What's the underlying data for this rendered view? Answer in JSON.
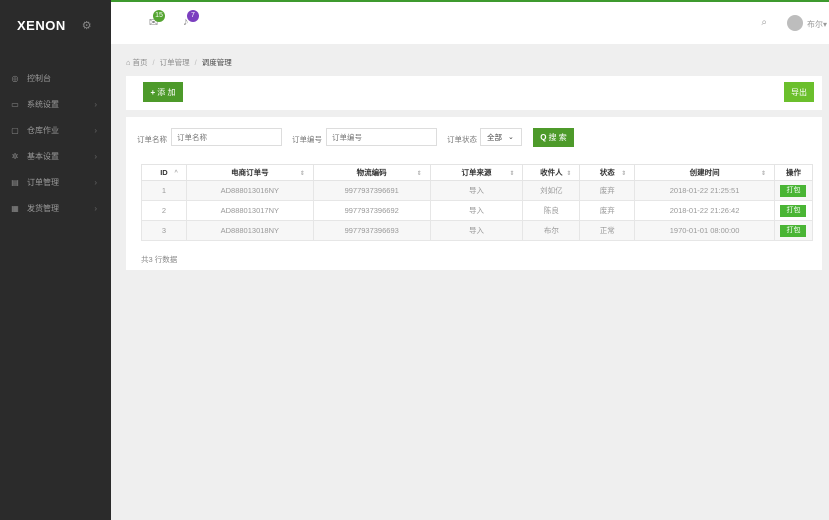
{
  "sidebar": {
    "brand": "XENON",
    "brand_icon": "gear-icon",
    "items": [
      {
        "icon": "dashboard-icon",
        "glyph": "◎",
        "label": "控制台",
        "has_children": false
      },
      {
        "icon": "monitor-icon",
        "glyph": "▭",
        "label": "系统设置",
        "has_children": true
      },
      {
        "icon": "warehouse-icon",
        "glyph": "▢",
        "label": "仓库作业",
        "has_children": true
      },
      {
        "icon": "settings-icon",
        "glyph": "✲",
        "label": "基本设置",
        "has_children": true
      },
      {
        "icon": "orders-icon",
        "glyph": "▤",
        "label": "订单管理",
        "has_children": true
      },
      {
        "icon": "shipping-icon",
        "glyph": "▦",
        "label": "发货管理",
        "has_children": true
      }
    ],
    "chevron": "›"
  },
  "header": {
    "messages_badge": "15",
    "notifications_badge": "7",
    "username": "布尔",
    "user_caret": "▾"
  },
  "breadcrumb": {
    "home": "首页",
    "parent": "订单管理",
    "current": "调度管理",
    "separator": "/"
  },
  "toolbar": {
    "add_label": "添 加",
    "add_glyph": "+",
    "export_label": "导出"
  },
  "filters": {
    "order_name_label": "订单名称",
    "order_name_placeholder": "订单名称",
    "order_no_label": "订单编号",
    "order_no_placeholder": "订单编号",
    "status_label": "订单状态",
    "status_value": "全部",
    "search_label": "搜 索",
    "search_glyph": "Q"
  },
  "table": {
    "columns": [
      "ID",
      "电商订单号",
      "物流编码",
      "订单来源",
      "收件人",
      "状态",
      "创建时间",
      "操作"
    ],
    "sort_glyph": "⇕",
    "sort_asc_glyph": "^",
    "rows": [
      {
        "id": "1",
        "ecom_no": "AD888013016NY",
        "logistics": "9977937396691",
        "source": "导入",
        "recipient": "刘如亿",
        "status": "废弃",
        "created": "2018-01-22 21:25:51",
        "action": "打包"
      },
      {
        "id": "2",
        "ecom_no": "AD888013017NY",
        "logistics": "9977937396692",
        "source": "导入",
        "recipient": "陈良",
        "status": "废弃",
        "created": "2018-01-22 21:26:42",
        "action": "打包"
      },
      {
        "id": "3",
        "ecom_no": "AD888013018NY",
        "logistics": "9977937396693",
        "source": "导入",
        "recipient": "布尔",
        "status": "正常",
        "created": "1970-01-01 08:00:00",
        "action": "打包"
      }
    ],
    "summary": "共3 行数据"
  },
  "colors": {
    "accent": "#4d9a2a",
    "export": "#6bbf2c",
    "sidebar_bg": "#2b2b2b",
    "badge_green": "#55a532",
    "badge_purple": "#7b3fbf"
  }
}
